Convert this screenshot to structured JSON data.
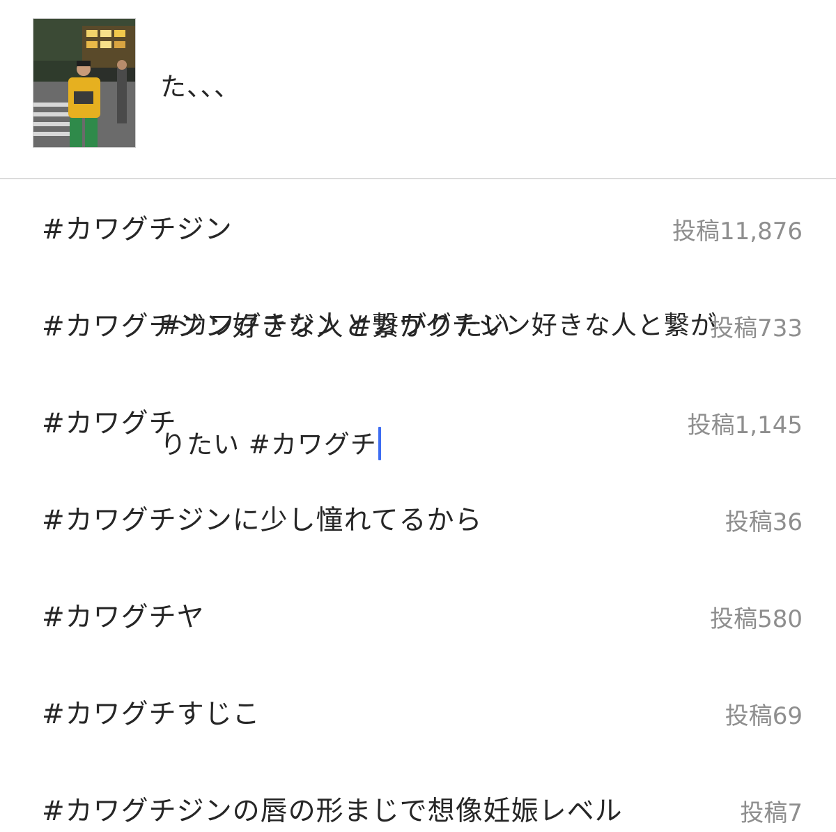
{
  "composer": {
    "caption_lines": [
      "た、、、",
      "",
      "#カワグチジン #カワグチジン好きな人と繋が",
      "りたい #カワグチ"
    ],
    "cursor_color": "#3d6df2"
  },
  "suggestions": [
    {
      "tag": "#カワグチジン",
      "count": "投稿11,876"
    },
    {
      "tag": "#カワグチジン好きな人と繋がりたい",
      "count": "投稿733"
    },
    {
      "tag": "#カワグチ",
      "count": "投稿1,145"
    },
    {
      "tag": "#カワグチジンに少し憧れてるから",
      "count": "投稿36"
    },
    {
      "tag": "#カワグチヤ",
      "count": "投稿580"
    },
    {
      "tag": "#カワグチすじこ",
      "count": "投稿69"
    },
    {
      "tag": "#カワグチジンの唇の形まじで想像妊娠レベル",
      "count": "投稿7"
    }
  ]
}
